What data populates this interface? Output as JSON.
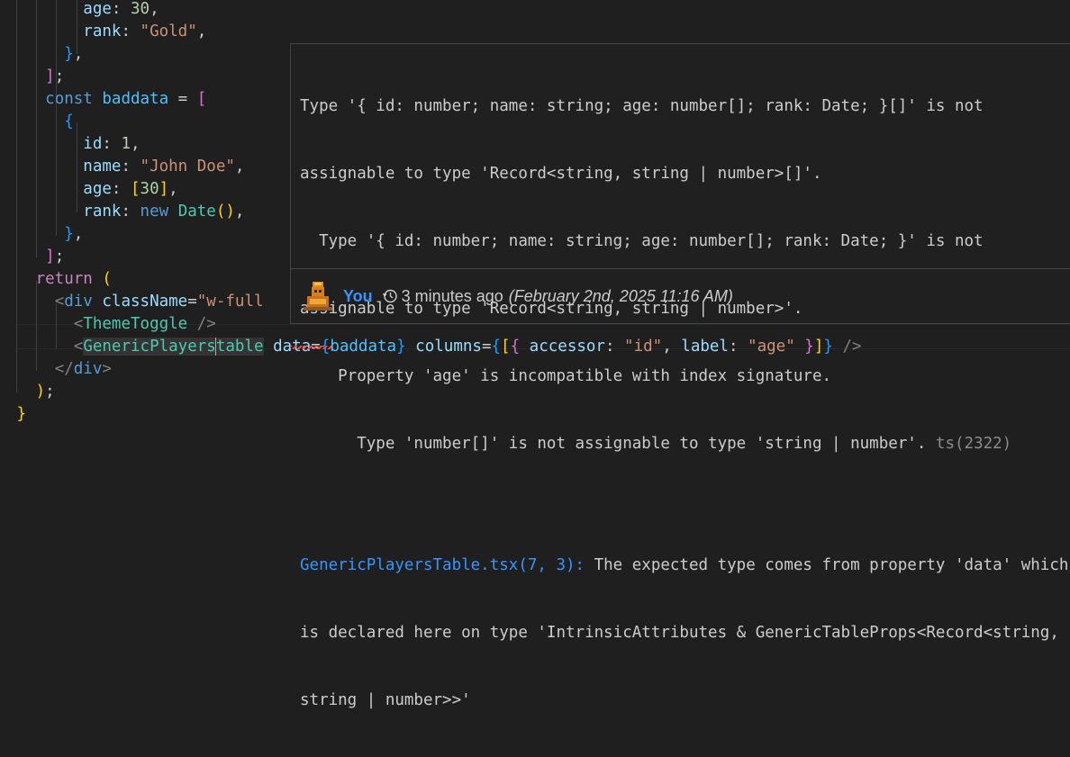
{
  "editor": {
    "lines": [
      {
        "indent": "        ",
        "tokens": [
          {
            "t": "age",
            "c": "prop"
          },
          {
            "t": ": ",
            "c": "pun"
          },
          {
            "t": "30",
            "c": "num"
          },
          {
            "t": ",",
            "c": "pun"
          }
        ]
      },
      {
        "indent": "        ",
        "tokens": [
          {
            "t": "rank",
            "c": "prop"
          },
          {
            "t": ": ",
            "c": "pun"
          },
          {
            "t": "\"Gold\"",
            "c": "str"
          },
          {
            "t": ",",
            "c": "pun"
          }
        ]
      },
      {
        "indent": "      ",
        "tokens": [
          {
            "t": "}",
            "c": "br3"
          },
          {
            "t": ",",
            "c": "pun"
          }
        ]
      },
      {
        "indent": "    ",
        "tokens": [
          {
            "t": "]",
            "c": "br2"
          },
          {
            "t": ";",
            "c": "pun"
          }
        ]
      },
      {
        "indent": "    ",
        "tokens": [
          {
            "t": "const ",
            "c": "kw"
          },
          {
            "t": "baddata",
            "c": "var"
          },
          {
            "t": " = ",
            "c": "pun"
          },
          {
            "t": "[",
            "c": "br2"
          }
        ]
      },
      {
        "indent": "      ",
        "tokens": [
          {
            "t": "{",
            "c": "br3"
          }
        ]
      },
      {
        "indent": "        ",
        "tokens": [
          {
            "t": "id",
            "c": "prop"
          },
          {
            "t": ": ",
            "c": "pun"
          },
          {
            "t": "1",
            "c": "num"
          },
          {
            "t": ",",
            "c": "pun"
          }
        ]
      },
      {
        "indent": "        ",
        "tokens": [
          {
            "t": "name",
            "c": "prop"
          },
          {
            "t": ": ",
            "c": "pun"
          },
          {
            "t": "\"John Doe\"",
            "c": "str"
          },
          {
            "t": ",",
            "c": "pun"
          }
        ]
      },
      {
        "indent": "        ",
        "tokens": [
          {
            "t": "age",
            "c": "prop"
          },
          {
            "t": ": ",
            "c": "pun"
          },
          {
            "t": "[",
            "c": "br1"
          },
          {
            "t": "30",
            "c": "num"
          },
          {
            "t": "]",
            "c": "br1"
          },
          {
            "t": ",",
            "c": "pun"
          }
        ]
      },
      {
        "indent": "        ",
        "tokens": [
          {
            "t": "rank",
            "c": "prop"
          },
          {
            "t": ": ",
            "c": "pun"
          },
          {
            "t": "new ",
            "c": "kw"
          },
          {
            "t": "Date",
            "c": "cls"
          },
          {
            "t": "()",
            "c": "br1"
          },
          {
            "t": ",",
            "c": "pun"
          }
        ]
      },
      {
        "indent": "      ",
        "tokens": [
          {
            "t": "}",
            "c": "br3"
          },
          {
            "t": ",",
            "c": "pun"
          }
        ]
      },
      {
        "indent": "    ",
        "tokens": [
          {
            "t": "]",
            "c": "br2"
          },
          {
            "t": ";",
            "c": "pun"
          }
        ]
      },
      {
        "indent": "   ",
        "tokens": [
          {
            "t": "return ",
            "c": "ctrl"
          },
          {
            "t": "(",
            "c": "br1"
          }
        ]
      },
      {
        "indent": "     ",
        "tokens": [
          {
            "t": "<",
            "c": "tagb"
          },
          {
            "t": "div",
            "c": "kw"
          },
          {
            "t": " ",
            "c": "pun"
          },
          {
            "t": "className",
            "c": "attr"
          },
          {
            "t": "=",
            "c": "pun"
          },
          {
            "t": "\"w-full",
            "c": "str"
          }
        ]
      },
      {
        "indent": "       ",
        "tokens": [
          {
            "t": "<",
            "c": "tagb"
          },
          {
            "t": "ThemeToggle",
            "c": "tag"
          },
          {
            "t": " />",
            "c": "tagb"
          }
        ]
      },
      {
        "indent": "       ",
        "tokens": [
          {
            "t": "<",
            "c": "tagb"
          },
          {
            "t": "GenericPlayers",
            "c": "tag hl-word"
          },
          {
            "t": "|",
            "c": "cursor"
          },
          {
            "t": "table",
            "c": "tag hl-word"
          },
          {
            "t": " ",
            "c": "pun"
          },
          {
            "t": "data",
            "c": "attr"
          },
          {
            "t": "=",
            "c": "pun"
          },
          {
            "t": "{",
            "c": "br3"
          },
          {
            "t": "baddata",
            "c": "var"
          },
          {
            "t": "}",
            "c": "br3"
          },
          {
            "t": " ",
            "c": "pun"
          },
          {
            "t": "columns",
            "c": "attr"
          },
          {
            "t": "=",
            "c": "pun"
          },
          {
            "t": "{",
            "c": "br3"
          },
          {
            "t": "[",
            "c": "br1"
          },
          {
            "t": "{",
            "c": "br2"
          },
          {
            "t": " ",
            "c": "pun"
          },
          {
            "t": "accessor",
            "c": "prop"
          },
          {
            "t": ": ",
            "c": "pun"
          },
          {
            "t": "\"id\"",
            "c": "str"
          },
          {
            "t": ", ",
            "c": "pun"
          },
          {
            "t": "label",
            "c": "prop"
          },
          {
            "t": ": ",
            "c": "pun"
          },
          {
            "t": "\"age\"",
            "c": "str"
          },
          {
            "t": " ",
            "c": "pun"
          },
          {
            "t": "}",
            "c": "br2"
          },
          {
            "t": "]",
            "c": "br1"
          },
          {
            "t": "}",
            "c": "br3"
          },
          {
            "t": " />",
            "c": "tagb"
          }
        ]
      },
      {
        "indent": "     ",
        "tokens": [
          {
            "t": "</",
            "c": "tagb"
          },
          {
            "t": "div",
            "c": "kw"
          },
          {
            "t": ">",
            "c": "tagb"
          }
        ]
      },
      {
        "indent": "   ",
        "tokens": [
          {
            "t": ")",
            "c": "br1"
          },
          {
            "t": ";",
            "c": "pun"
          }
        ]
      },
      {
        "indent": " ",
        "tokens": [
          {
            "t": "}",
            "c": "br1"
          }
        ]
      }
    ]
  },
  "hover": {
    "error_lines": [
      "Type '{ id: number; name: string; age: number[]; rank: Date; }[]' is not",
      "assignable to type 'Record<string, string | number>[]'.",
      "  Type '{ id: number; name: string; age: number[]; rank: Date; }' is not",
      "assignable to type 'Record<string, string | number>'.",
      "    Property 'age' is incompatible with index signature.",
      "      Type 'number[]' is not assignable to type 'string | number'."
    ],
    "error_code": "ts(2322)",
    "related_link": "GenericPlayersTable.tsx(7, 3):",
    "related_line1": " The expected type comes from property 'data' which",
    "related_line2": "is declared here on type 'IntrinsicAttributes & GenericTableProps<Record<string,",
    "related_line3": "string | number>>'",
    "blame": {
      "author": "You",
      "relative_time": "3 minutes ago",
      "date": "(February 2nd, 2025 11:16 AM)",
      "avatar_icon": "robot-avatar-icon",
      "history_icon": "history-clock-icon"
    }
  }
}
